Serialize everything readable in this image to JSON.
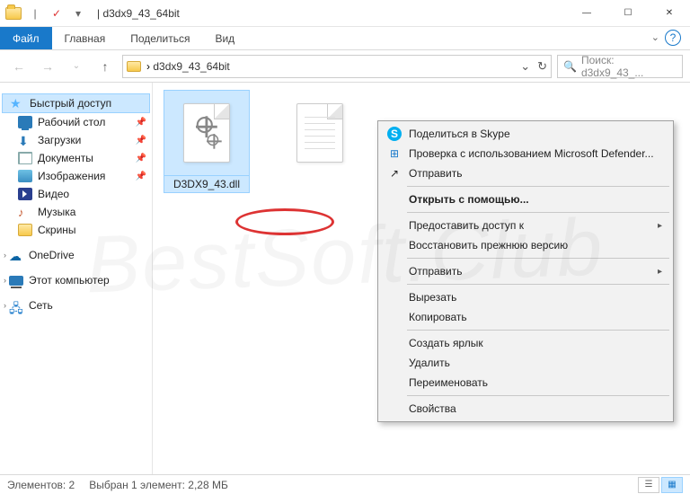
{
  "titlebar": {
    "title": "d3dx9_43_64bit",
    "qat": {
      "props": "",
      "check": "✓",
      "overflow": "▾"
    },
    "win": {
      "min": "—",
      "max": "☐",
      "close": "✕"
    }
  },
  "ribbon": {
    "file": "Файл",
    "home": "Главная",
    "share": "Поделиться",
    "view": "Вид",
    "collapse": "⌄",
    "help": "?"
  },
  "address": {
    "back": "←",
    "forward": "→",
    "recent": "⌄",
    "up": "↑",
    "sep": "›",
    "crumb": "d3dx9_43_64bit",
    "dropdown": "⌄",
    "refresh": "↻",
    "search_icon": "🔍",
    "search_placeholder": "Поиск: d3dx9_43_..."
  },
  "sidebar": {
    "quick": {
      "label": "Быстрый доступ",
      "icon": "★"
    },
    "desktop": {
      "label": "Рабочий стол"
    },
    "downloads": {
      "label": "Загрузки"
    },
    "documents": {
      "label": "Документы"
    },
    "pictures": {
      "label": "Изображения"
    },
    "videos": {
      "label": "Видео"
    },
    "music": {
      "label": "Музыка",
      "icon": "♪"
    },
    "screens": {
      "label": "Скрины"
    },
    "onedrive": {
      "label": "OneDrive",
      "icon": "☁"
    },
    "thispc": {
      "label": "Этот компьютер"
    },
    "network": {
      "label": "Сеть",
      "icon": "🖧"
    },
    "pin": "📌",
    "expand": "›"
  },
  "files": {
    "item1": {
      "name": "D3DX9_43.dll"
    },
    "item2": {
      "name": ""
    }
  },
  "contextmenu": {
    "skype": "Поделиться в Skype",
    "defender": "Проверка с использованием Microsoft Defender...",
    "share": "Отправить",
    "openwith": "Открыть с помощью...",
    "giveaccess": "Предоставить доступ к",
    "restore": "Восстановить прежнюю версию",
    "sendto": "Отправить",
    "cut": "Вырезать",
    "copy": "Копировать",
    "shortcut": "Создать ярлык",
    "delete": "Удалить",
    "rename": "Переименовать",
    "props": "Свойства",
    "arrow": "▸",
    "icons": {
      "skype": "S",
      "defender": "⊞",
      "share": "↗"
    }
  },
  "status": {
    "count": "Элементов: 2",
    "selection": "Выбран 1 элемент: 2,28 МБ"
  },
  "watermark": "BestSoft.Club"
}
